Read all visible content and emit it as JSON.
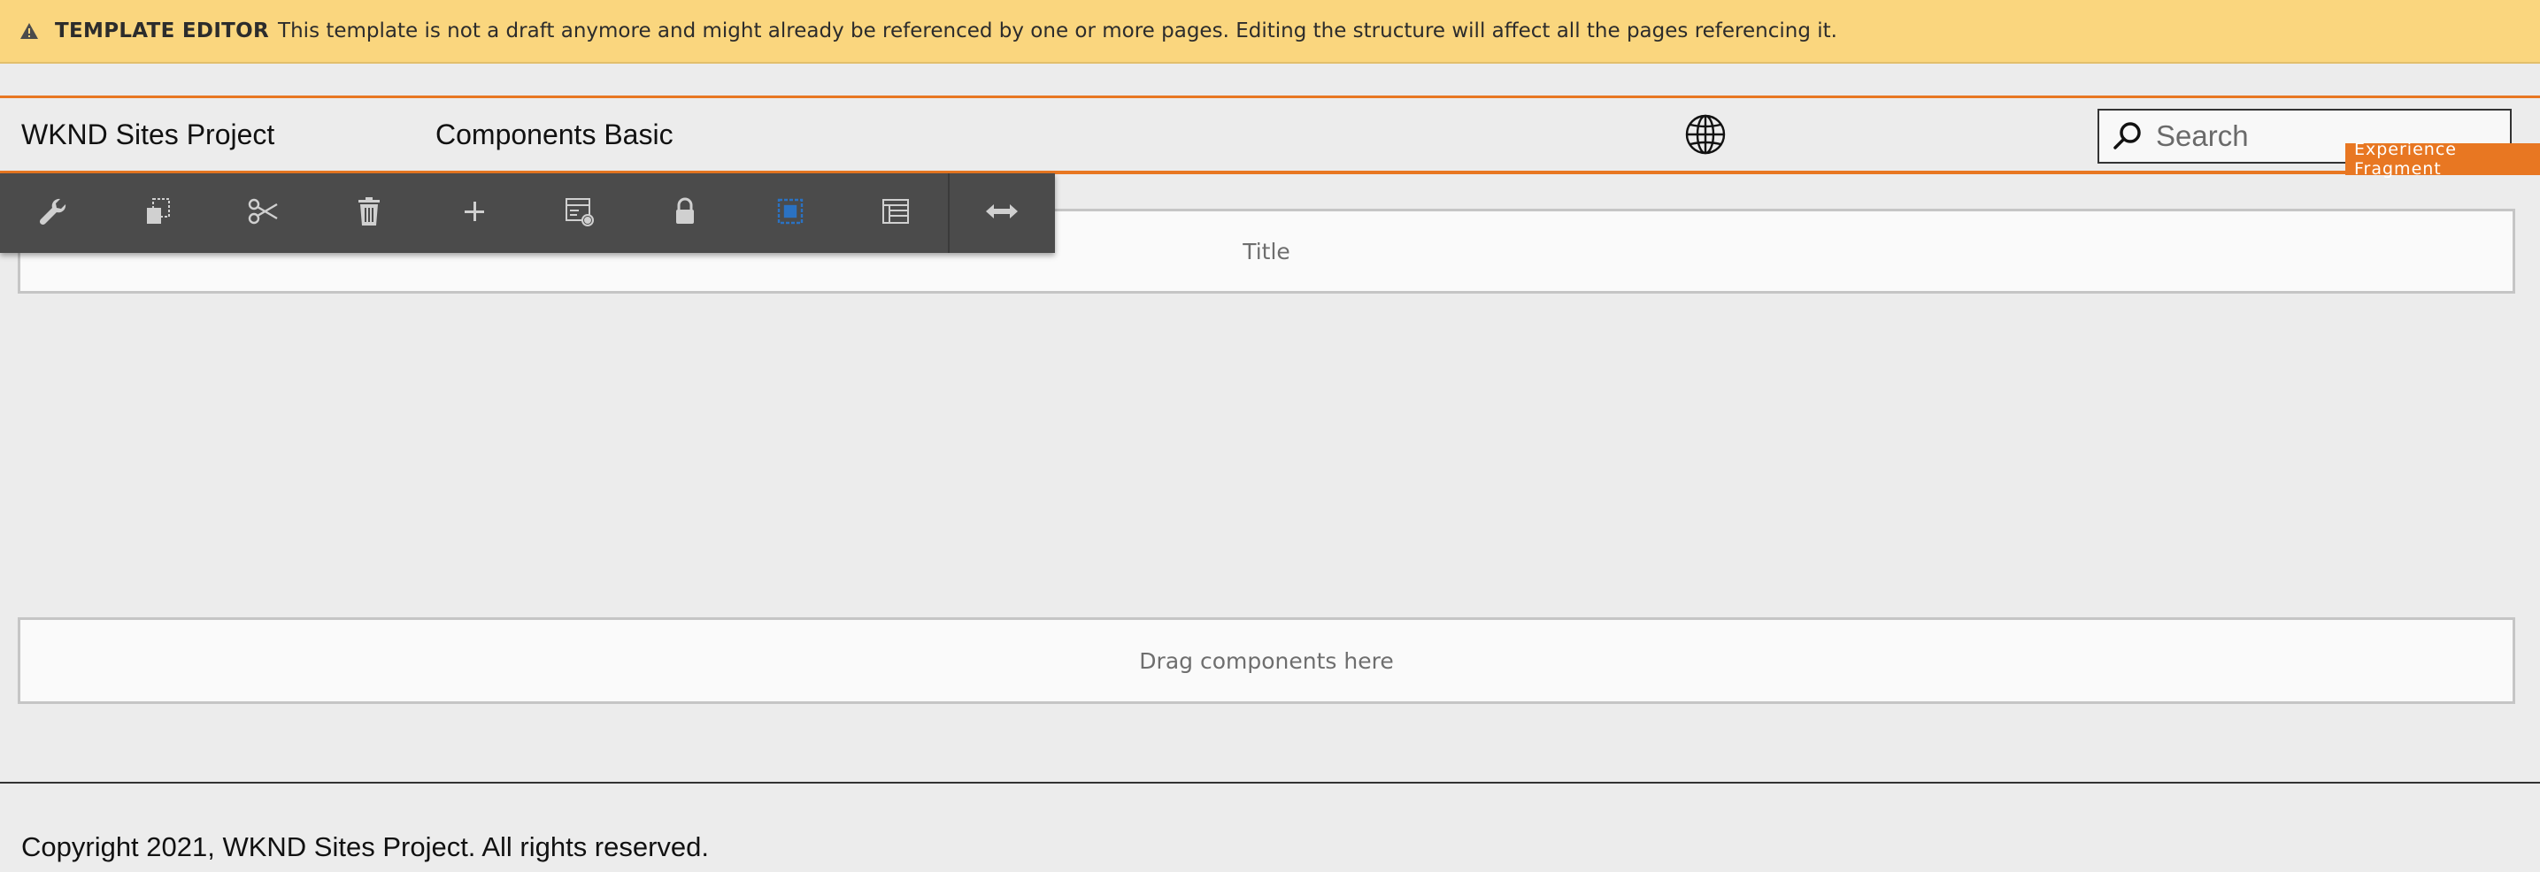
{
  "banner": {
    "label": "TEMPLATE EDITOR",
    "message": "This template is not a draft anymore and might already be referenced by one or more pages. Editing the structure will affect all the pages referencing it.",
    "icon": "warning-icon",
    "color": "#fad67e"
  },
  "header": {
    "site_title": "WKND Sites Project",
    "nav_item": "Components Basic",
    "language_icon": "globe-icon",
    "search_placeholder": "Search",
    "accent_color": "#e87722"
  },
  "badge": {
    "label": "Experience Fragment"
  },
  "toolbar": {
    "items": [
      {
        "name": "configure",
        "icon": "wrench-icon"
      },
      {
        "name": "copy",
        "icon": "copy-icon"
      },
      {
        "name": "cut",
        "icon": "scissors-icon"
      },
      {
        "name": "delete",
        "icon": "trash-icon"
      },
      {
        "name": "insert",
        "icon": "plus-icon"
      },
      {
        "name": "policy",
        "icon": "policy-icon"
      },
      {
        "name": "lock",
        "icon": "lock-icon"
      },
      {
        "name": "parent",
        "icon": "select-parent-icon",
        "active": true
      },
      {
        "name": "layout",
        "icon": "layout-icon"
      },
      {
        "name": "resize",
        "icon": "resize-arrows-icon"
      }
    ],
    "active_color": "#2b72c2"
  },
  "content": {
    "title_placeholder": "Title",
    "drop_zone": "Drag components here"
  },
  "footer": {
    "copyright": "Copyright 2021, WKND Sites Project. All rights reserved."
  }
}
